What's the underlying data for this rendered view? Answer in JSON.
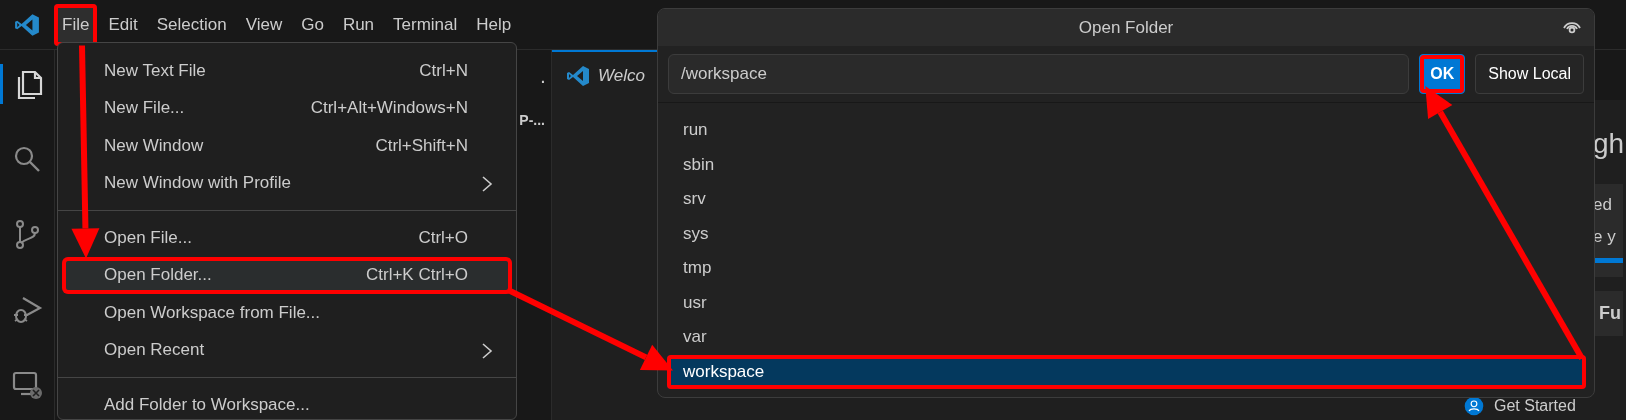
{
  "menubar": [
    {
      "label": "File",
      "open": true,
      "highlighted": true
    },
    {
      "label": "Edit",
      "open": false,
      "highlighted": false
    },
    {
      "label": "Selection",
      "open": false,
      "highlighted": false
    },
    {
      "label": "View",
      "open": false,
      "highlighted": false
    },
    {
      "label": "Go",
      "open": false,
      "highlighted": false
    },
    {
      "label": "Run",
      "open": false,
      "highlighted": false
    },
    {
      "label": "Terminal",
      "open": false,
      "highlighted": false
    },
    {
      "label": "Help",
      "open": false,
      "highlighted": false
    }
  ],
  "activity_bar": [
    {
      "kind": "explorer",
      "selected": true
    },
    {
      "kind": "search",
      "selected": false
    },
    {
      "kind": "source_control",
      "selected": false
    },
    {
      "kind": "run_debug",
      "selected": false
    },
    {
      "kind": "remote",
      "selected": false
    }
  ],
  "sidebar": {
    "items": [
      {
        "label": "."
      },
      {
        "label": "P-..."
      }
    ]
  },
  "editor": {
    "tabs": [
      {
        "label": "Welco",
        "selected": true
      }
    ],
    "welcome": {
      "heading": "gh",
      "card_lines": [
        "ed",
        "e y"
      ],
      "progress": {
        "level": 1
      },
      "card_title": "Fu",
      "footer_link": "Get Started"
    }
  },
  "file_menu": [
    {
      "kind": "item",
      "label": "New Text File",
      "shortcut": "Ctrl+N",
      "submenu": false,
      "hovered": false,
      "highlighted": false
    },
    {
      "kind": "item",
      "label": "New File...",
      "shortcut": "Ctrl+Alt+Windows+N",
      "submenu": false,
      "hovered": false,
      "highlighted": false
    },
    {
      "kind": "item",
      "label": "New Window",
      "shortcut": "Ctrl+Shift+N",
      "submenu": false,
      "hovered": false,
      "highlighted": false
    },
    {
      "kind": "item",
      "label": "New Window with Profile",
      "submenu": true,
      "hovered": false,
      "highlighted": false
    },
    {
      "kind": "separator"
    },
    {
      "kind": "item",
      "label": "Open File...",
      "shortcut": "Ctrl+O",
      "submenu": false,
      "hovered": false,
      "highlighted": false
    },
    {
      "kind": "item",
      "label": "Open Folder...",
      "shortcut": "Ctrl+K Ctrl+O",
      "submenu": false,
      "hovered": true,
      "highlighted": true
    },
    {
      "kind": "item",
      "label": "Open Workspace from File...",
      "submenu": false,
      "hovered": false,
      "highlighted": false
    },
    {
      "kind": "item",
      "label": "Open Recent",
      "submenu": true,
      "hovered": false,
      "highlighted": false
    },
    {
      "kind": "separator"
    },
    {
      "kind": "item",
      "label": "Add Folder to Workspace...",
      "submenu": false,
      "hovered": false,
      "highlighted": false
    }
  ],
  "dialog": {
    "title": "Open Folder",
    "path": "/workspace",
    "buttons": [
      {
        "label": "OK",
        "primary": true,
        "highlighted": true
      },
      {
        "label": "Show Local",
        "primary": false,
        "highlighted": false
      }
    ],
    "entries": [
      {
        "name": "run",
        "selected": false,
        "highlighted": false
      },
      {
        "name": "sbin",
        "selected": false,
        "highlighted": false
      },
      {
        "name": "srv",
        "selected": false,
        "highlighted": false
      },
      {
        "name": "sys",
        "selected": false,
        "highlighted": false
      },
      {
        "name": "tmp",
        "selected": false,
        "highlighted": false
      },
      {
        "name": "usr",
        "selected": false,
        "highlighted": false
      },
      {
        "name": "var",
        "selected": false,
        "highlighted": false
      },
      {
        "name": "workspace",
        "selected": true,
        "highlighted": true
      }
    ]
  }
}
